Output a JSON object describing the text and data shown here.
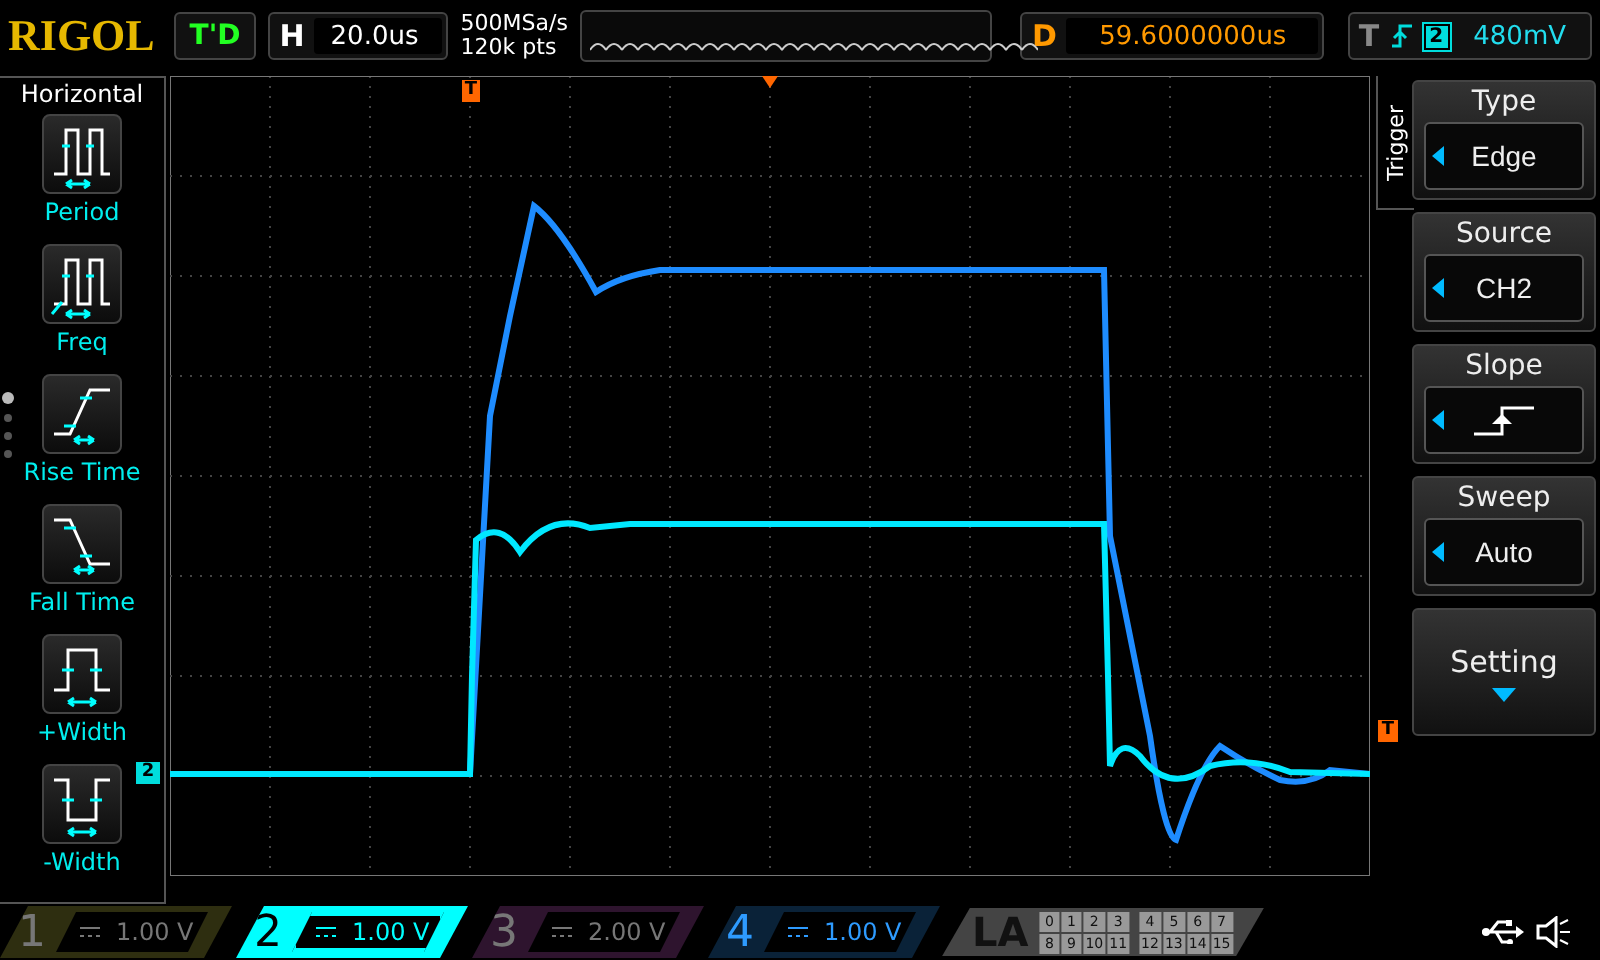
{
  "top_bar": {
    "logo": "RIGOL",
    "run_status": "T'D",
    "timebase": {
      "label": "H",
      "value": "20.0us"
    },
    "sample_rate": "500MSa/s",
    "memory_depth": "120k pts",
    "delay": {
      "label": "D",
      "value": "59.6000000us"
    },
    "trigger": {
      "label": "T",
      "source": "2",
      "level": "480mV"
    }
  },
  "left_panel": {
    "title": "Horizontal",
    "items": [
      {
        "kind": "period",
        "label": "Period"
      },
      {
        "kind": "freq",
        "label": "Freq"
      },
      {
        "kind": "rise",
        "label": "Rise Time"
      },
      {
        "kind": "fall",
        "label": "Fall Time"
      },
      {
        "kind": "pwidth",
        "label": "+Width"
      },
      {
        "kind": "nwidth",
        "label": "-Width"
      }
    ],
    "pages": [
      {
        "selected": true
      },
      {
        "selected": false
      },
      {
        "selected": false
      },
      {
        "selected": false
      }
    ]
  },
  "screen": {
    "trigger_position_marker": "T",
    "trigger_level_marker": "T",
    "channel_marker": "2"
  },
  "right_menu": {
    "title": "Trigger",
    "items": [
      {
        "kind": "select",
        "title": "Type",
        "value": "Edge"
      },
      {
        "kind": "select",
        "title": "Source",
        "value": "CH2"
      },
      {
        "kind": "slope",
        "title": "Slope"
      },
      {
        "kind": "select",
        "title": "Sweep",
        "value": "Auto"
      },
      {
        "kind": "button",
        "title": "Setting"
      }
    ]
  },
  "channels": [
    {
      "number": "1",
      "scale": "1.00 V",
      "enabled": false,
      "selected": false,
      "color": "#2e2e10"
    },
    {
      "number": "2",
      "scale": "1.00 V",
      "enabled": true,
      "selected": true,
      "color": "#00ffff"
    },
    {
      "number": "3",
      "scale": "2.00 V",
      "enabled": false,
      "selected": false,
      "color": "#2e142e"
    },
    {
      "number": "4",
      "scale": "1.00 V",
      "enabled": true,
      "selected": false,
      "color": "#0a2238"
    }
  ],
  "logic_analyzer": {
    "label": "LA",
    "bits": [
      "0",
      "1",
      "2",
      "3",
      "4",
      "5",
      "6",
      "7",
      "8",
      "9",
      "10",
      "11",
      "12",
      "13",
      "14",
      "15"
    ]
  }
}
